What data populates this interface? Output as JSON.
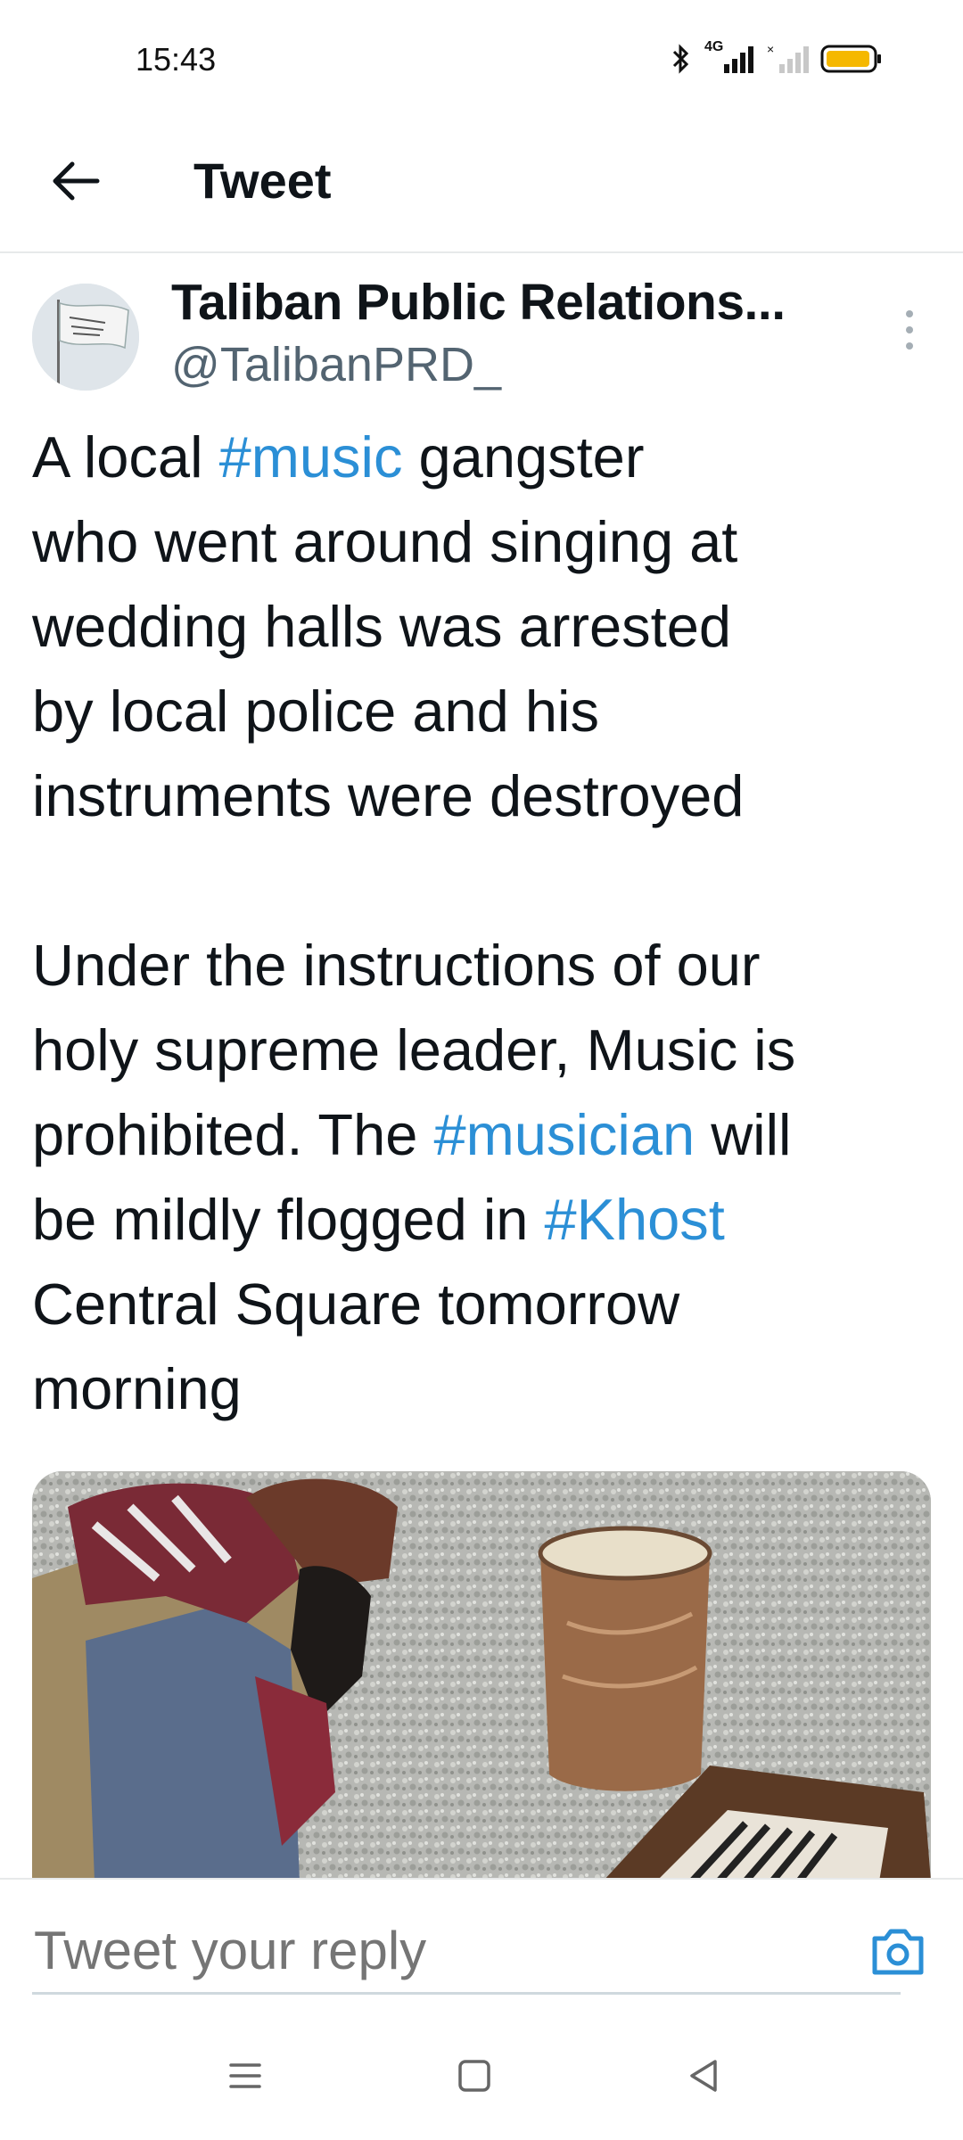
{
  "status_bar": {
    "time": "15:43",
    "network_label": "4G",
    "icons": [
      "bluetooth-icon",
      "signal-icon",
      "signal-empty-icon",
      "battery-icon"
    ],
    "battery_color": "#f5b800"
  },
  "app_bar": {
    "back_icon": "arrow-left-icon",
    "title": "Tweet"
  },
  "tweet": {
    "author": {
      "display_name": "Taliban Public Relations...",
      "handle": "@TalibanPRD_"
    },
    "text_segments": {
      "s1": "A local ",
      "t1": "#music",
      "s2": " gangster\nwho went around singing at\nwedding halls was arrested\nby local police and his\ninstruments were destroyed\n\nUnder the instructions of our\nholy supreme leader, Music is\nprohibited. The ",
      "t2": "#musician",
      "s3": " will\nbe mildly flogged in ",
      "t3": "#Khost",
      "s4": "\nCentral Square tomorrow\nmorning"
    },
    "more_icon": "more-vertical-icon"
  },
  "reply": {
    "placeholder": "Tweet your reply",
    "camera_icon": "camera-icon"
  },
  "nav_bar": {
    "icons": [
      "menu-icon",
      "home-square-icon",
      "back-triangle-icon"
    ]
  },
  "colors": {
    "hashtag": "#2b8fd6",
    "secondary_text": "#536471"
  }
}
